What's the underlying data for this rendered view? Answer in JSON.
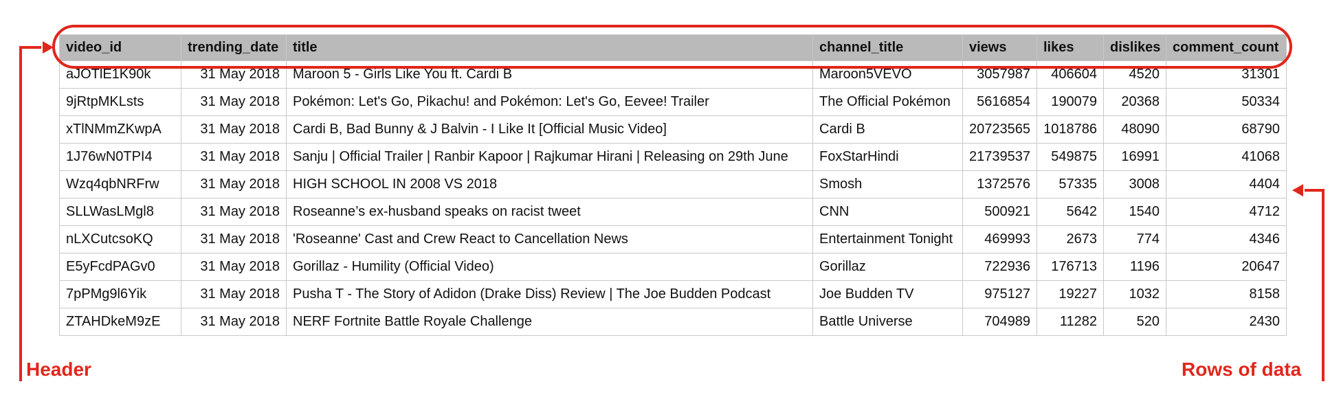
{
  "table": {
    "columns": [
      "video_id",
      "trending_date",
      "title",
      "channel_title",
      "views",
      "likes",
      "dislikes",
      "comment_count"
    ],
    "rows": [
      [
        "aJOTlE1K90k",
        "31 May 2018",
        "Maroon 5 - Girls Like You ft. Cardi B",
        "Maroon5VEVO",
        "3057987",
        "406604",
        "4520",
        "31301"
      ],
      [
        "9jRtpMKLsts",
        "31 May 2018",
        "Pokémon: Let's Go, Pikachu! and Pokémon: Let's Go, Eevee! Trailer",
        "The Official Pokémon",
        "5616854",
        "190079",
        "20368",
        "50334"
      ],
      [
        "xTlNMmZKwpA",
        "31 May 2018",
        "Cardi B, Bad Bunny & J Balvin - I Like It [Official Music Video]",
        "Cardi B",
        "20723565",
        "1018786",
        "48090",
        "68790"
      ],
      [
        "1J76wN0TPI4",
        "31 May 2018",
        "Sanju | Official Trailer | Ranbir Kapoor | Rajkumar Hirani | Releasing on 29th June",
        "FoxStarHindi",
        "21739537",
        "549875",
        "16991",
        "41068"
      ],
      [
        "Wzq4qbNRFrw",
        "31 May 2018",
        "HIGH SCHOOL IN 2008 VS 2018",
        "Smosh",
        "1372576",
        "57335",
        "3008",
        "4404"
      ],
      [
        "SLLWasLMgl8",
        "31 May 2018",
        "Roseanne’s ex-husband speaks on racist tweet",
        "CNN",
        "500921",
        "5642",
        "1540",
        "4712"
      ],
      [
        "nLXCutcsoKQ",
        "31 May 2018",
        "'Roseanne' Cast and Crew React to Cancellation News",
        "Entertainment Tonight",
        "469993",
        "2673",
        "774",
        "4346"
      ],
      [
        "E5yFcdPAGv0",
        "31 May 2018",
        "Gorillaz - Humility (Official Video)",
        "Gorillaz",
        "722936",
        "176713",
        "1196",
        "20647"
      ],
      [
        "7pPMg9l6Yik",
        "31 May 2018",
        "Pusha T - The Story of Adidon (Drake Diss) Review | The Joe Budden Podcast",
        "Joe Budden TV",
        "975127",
        "19227",
        "1032",
        "8158"
      ],
      [
        "ZTAHDkeM9zE",
        "31 May 2018",
        "NERF Fortnite Battle Royale Challenge",
        "Battle Universe",
        "704989",
        "11282",
        "520",
        "2430"
      ]
    ],
    "align": [
      "left",
      "right",
      "left",
      "left",
      "right",
      "right",
      "right",
      "right"
    ]
  },
  "annotations": {
    "header_label": "Header",
    "rows_label": "Rows of data",
    "color": "#e1261c"
  }
}
